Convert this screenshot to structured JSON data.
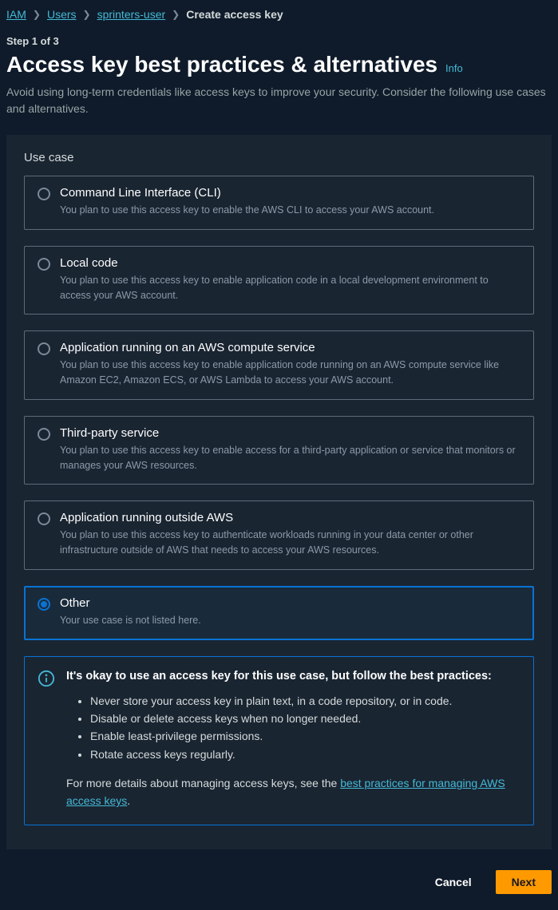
{
  "breadcrumb": {
    "items": [
      {
        "label": "IAM",
        "link": true
      },
      {
        "label": "Users",
        "link": true
      },
      {
        "label": "sprinters-user",
        "link": true
      },
      {
        "label": "Create access key",
        "link": false
      }
    ]
  },
  "step": "Step 1 of 3",
  "title": "Access key best practices & alternatives",
  "info_link": "Info",
  "subtitle": "Avoid using long-term credentials like access keys to improve your security. Consider the following use cases and alternatives.",
  "section_label": "Use case",
  "options": [
    {
      "title": "Command Line Interface (CLI)",
      "desc": "You plan to use this access key to enable the AWS CLI to access your AWS account.",
      "selected": false
    },
    {
      "title": "Local code",
      "desc": "You plan to use this access key to enable application code in a local development environment to access your AWS account.",
      "selected": false
    },
    {
      "title": "Application running on an AWS compute service",
      "desc": "You plan to use this access key to enable application code running on an AWS compute service like Amazon EC2, Amazon ECS, or AWS Lambda to access your AWS account.",
      "selected": false
    },
    {
      "title": "Third-party service",
      "desc": "You plan to use this access key to enable access for a third-party application or service that monitors or manages your AWS resources.",
      "selected": false
    },
    {
      "title": "Application running outside AWS",
      "desc": "You plan to use this access key to authenticate workloads running in your data center or other infrastructure outside of AWS that needs to access your AWS resources.",
      "selected": false
    },
    {
      "title": "Other",
      "desc": "Your use case is not listed here.",
      "selected": true
    }
  ],
  "info_box": {
    "heading": "It's okay to use an access key for this use case, but follow the best practices:",
    "bullets": [
      "Never store your access key in plain text, in a code repository, or in code.",
      "Disable or delete access keys when no longer needed.",
      "Enable least-privilege permissions.",
      "Rotate access keys regularly."
    ],
    "more_prefix": "For more details about managing access keys, see the ",
    "more_link": "best practices for managing AWS access keys",
    "more_suffix": "."
  },
  "footer": {
    "cancel": "Cancel",
    "next": "Next"
  }
}
